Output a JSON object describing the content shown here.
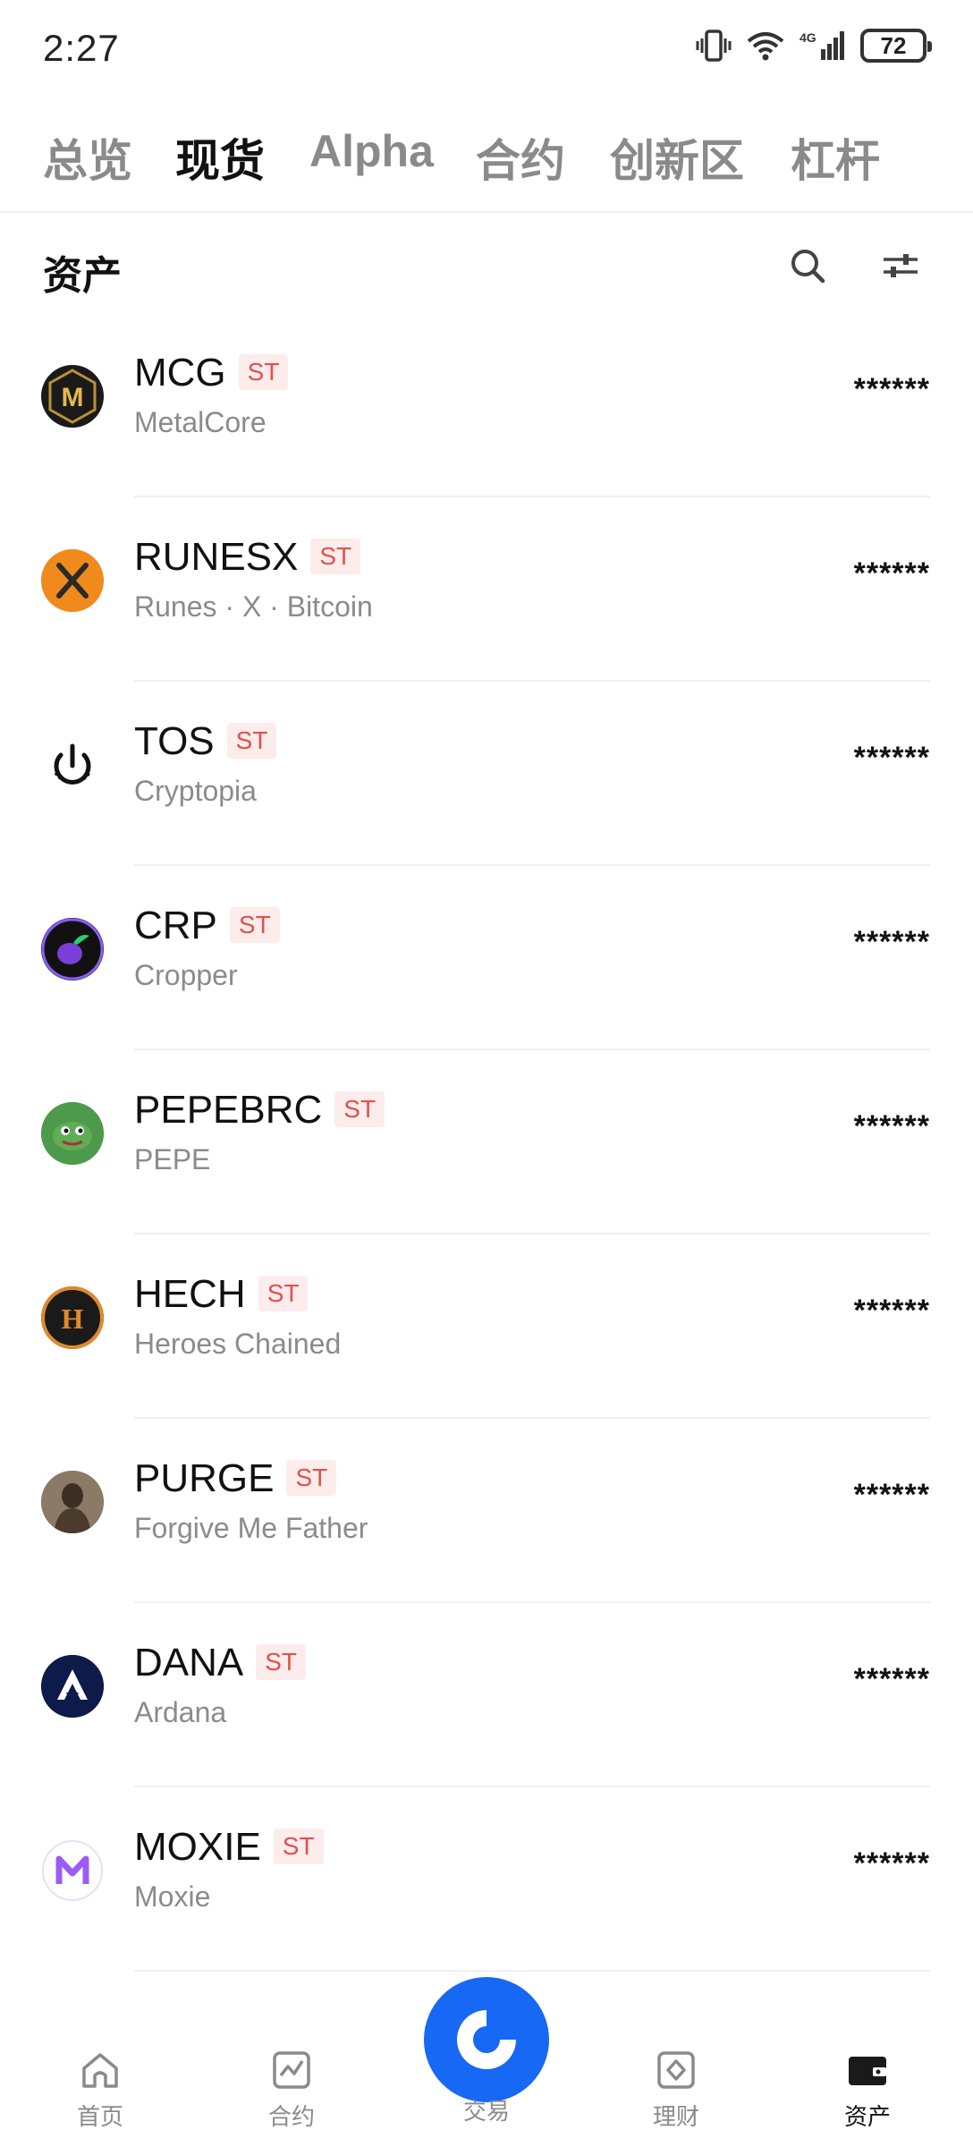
{
  "status": {
    "time": "2:27",
    "battery": "72",
    "network": "4G"
  },
  "tabs": [
    {
      "label": "总览",
      "active": false
    },
    {
      "label": "现货",
      "active": true
    },
    {
      "label": "Alpha",
      "active": false
    },
    {
      "label": "合约",
      "active": false
    },
    {
      "label": "创新区",
      "active": false
    },
    {
      "label": "杠杆",
      "active": false
    }
  ],
  "assets": {
    "title": "资产",
    "search_icon": "search-icon",
    "filter_icon": "filter-sliders-icon"
  },
  "list": [
    {
      "symbol": "MCG",
      "badge": "ST",
      "name": "MetalCore",
      "balance": "******",
      "logo_color": "#1a1a1a"
    },
    {
      "symbol": "RUNESX",
      "badge": "ST",
      "name": "Runes · X · Bitcoin",
      "balance": "******",
      "logo_color": "#f7931a"
    },
    {
      "symbol": "TOS",
      "badge": "ST",
      "name": "Cryptopia",
      "balance": "******",
      "logo_color": "#ffffff"
    },
    {
      "symbol": "CRP",
      "badge": "ST",
      "name": "Cropper",
      "balance": "******",
      "logo_color": "#111111"
    },
    {
      "symbol": "PEPEBRC",
      "badge": "ST",
      "name": "PEPE",
      "balance": "******",
      "logo_color": "#3d8c40"
    },
    {
      "symbol": "HECH",
      "badge": "ST",
      "name": "Heroes Chained",
      "balance": "******",
      "logo_color": "#1a1a1a"
    },
    {
      "symbol": "PURGE",
      "badge": "ST",
      "name": "Forgive Me Father",
      "balance": "******",
      "logo_color": "#6b5a4a"
    },
    {
      "symbol": "DANA",
      "badge": "ST",
      "name": "Ardana",
      "balance": "******",
      "logo_color": "#0d1a4a"
    },
    {
      "symbol": "MOXIE",
      "badge": "ST",
      "name": "Moxie",
      "balance": "******",
      "logo_color": "#ffffff"
    }
  ],
  "nav": {
    "home": "首页",
    "futures": "合约",
    "trade": "交易",
    "earn": "理财",
    "assets": "资产"
  },
  "colors": {
    "accent": "#1668f5",
    "badge_text": "#e2504c",
    "badge_bg": "#fdecec"
  }
}
